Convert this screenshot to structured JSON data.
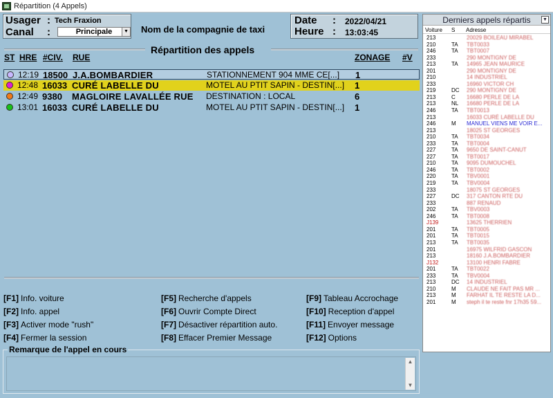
{
  "window": {
    "title": "Répartition (4 Appels)"
  },
  "header": {
    "usager_label": "Usager",
    "usager_sep": ":",
    "usager_value": "Tech Fraxion",
    "canal_label": "Canal",
    "canal_sep": ":",
    "canal_value": "Principale",
    "company": "Nom de la compagnie de taxi",
    "date_label": "Date",
    "date_sep": ":",
    "date_value": "2022/04/21",
    "heure_label": "Heure",
    "heure_sep": ":",
    "heure_value": "13:03:45"
  },
  "repartition": {
    "title": "Répartition des appels",
    "columns": {
      "st": "ST",
      "hre": "HRE",
      "civ": "#CIV.",
      "rue": "RUE",
      "zonage": "ZONAGE",
      "v": "#V"
    },
    "rows": [
      {
        "status_color": "#c8b8ff",
        "hre": "12:19",
        "civ": "18500",
        "rue": "J.A.BOMBARDIER",
        "dest": "STATIONNEMENT 904   MME CE[...]",
        "zone": "1"
      },
      {
        "status_color": "#e020d0",
        "hre": "12:48",
        "civ": "16033",
        "rue": "CURÉ LABELLE DU",
        "dest": "MOTEL AU PTIT SAPIN - DESTIN[...]",
        "zone": "1"
      },
      {
        "status_color": "#f07a18",
        "hre": "12:49",
        "civ": "9380",
        "rue": "MAGLOIRE LAVALLÉE RUE",
        "dest": "DESTINATION : LOCAL",
        "zone": "6"
      },
      {
        "status_color": "#18c018",
        "hre": "13:01",
        "civ": "16033",
        "rue": "CURÉ LABELLE DU",
        "dest": "MOTEL AU PTIT SAPIN - DESTIN[...]",
        "zone": "1"
      }
    ]
  },
  "fkeys": [
    {
      "key": "[F1]",
      "label": "Info. voiture"
    },
    {
      "key": "[F2]",
      "label": "Info. appel"
    },
    {
      "key": "[F3]",
      "label": "Activer mode \"rush\""
    },
    {
      "key": "[F4]",
      "label": "Fermer la session"
    },
    {
      "key": "[F5]",
      "label": "Recherche d'appels"
    },
    {
      "key": "[F6]",
      "label": "Ouvrir Compte Direct"
    },
    {
      "key": "[F7]",
      "label": "Désactiver répartition auto."
    },
    {
      "key": "[F8]",
      "label": "Effacer Premier Message"
    },
    {
      "key": "[F9]",
      "label": "Tableau Accrochage"
    },
    {
      "key": "[F10]",
      "label": "Reception d'appel"
    },
    {
      "key": "[F11]",
      "label": "Envoyer message"
    },
    {
      "key": "[F12]",
      "label": "Options"
    }
  ],
  "remarque": {
    "title": "Remarque de l'appel en cours"
  },
  "panel": {
    "title": "Derniers appels répartis",
    "col_voiture": "Voiture",
    "col_s": "S",
    "col_adresse": "Adresse",
    "rows": [
      {
        "v": "213",
        "s": "",
        "a": "20029 BOILEAU MIRABEL"
      },
      {
        "v": "210",
        "s": "TA",
        "a": "TBT0033"
      },
      {
        "v": "246",
        "s": "TA",
        "a": "TBT0007"
      },
      {
        "v": "233",
        "s": "",
        "a": "290 MONTIGNY DE"
      },
      {
        "v": "213",
        "s": "TA",
        "a": "14965 JEAN MAURICE"
      },
      {
        "v": "201",
        "s": "",
        "a": "290 MONTIGNY DE"
      },
      {
        "v": "210",
        "s": "",
        "a": "14 INDUSTRIEL"
      },
      {
        "v": "233",
        "s": "",
        "a": "16960 VICTOR CH"
      },
      {
        "v": "219",
        "s": "DC",
        "a": "290 MONTIGNY DE"
      },
      {
        "v": "213",
        "s": "C",
        "a": "16680 PERLE DE LA"
      },
      {
        "v": "213",
        "s": "NL",
        "a": "16680 PERLE DE LA"
      },
      {
        "v": "246",
        "s": "TA",
        "a": "TBT0013"
      },
      {
        "v": "213",
        "s": "",
        "a": "16033 CURÉ LABELLE DU"
      },
      {
        "v": "246",
        "s": "M",
        "a": "MANUEL VIENS ME VOIR E..."
      },
      {
        "v": "213",
        "s": "",
        "a": "18025 ST GEORGES"
      },
      {
        "v": "210",
        "s": "TA",
        "a": "TBT0034"
      },
      {
        "v": "233",
        "s": "TA",
        "a": "TBT0004"
      },
      {
        "v": "227",
        "s": "TA",
        "a": "9650 DE SAINT-CANUT"
      },
      {
        "v": "227",
        "s": "TA",
        "a": "TBT0017"
      },
      {
        "v": "210",
        "s": "TA",
        "a": "9095 DUMOUCHEL"
      },
      {
        "v": "246",
        "s": "TA",
        "a": "TBT0002"
      },
      {
        "v": "220",
        "s": "TA",
        "a": "TBV0001"
      },
      {
        "v": "219",
        "s": "TA",
        "a": "TBV0004"
      },
      {
        "v": "233",
        "s": "",
        "a": "18075 ST GEORGES"
      },
      {
        "v": "227",
        "s": "DC",
        "a": "317 CANTON RTE DU"
      },
      {
        "v": "233",
        "s": "",
        "a": "887 RENAUD"
      },
      {
        "v": "202",
        "s": "TA",
        "a": "TBV0003"
      },
      {
        "v": "246",
        "s": "TA",
        "a": "TBT0008"
      },
      {
        "v": "J139",
        "s": "",
        "a": "13625 THERRIEN"
      },
      {
        "v": "201",
        "s": "TA",
        "a": "TBT0005"
      },
      {
        "v": "201",
        "s": "TA",
        "a": "TBT0015"
      },
      {
        "v": "213",
        "s": "TA",
        "a": "TBT0035"
      },
      {
        "v": "201",
        "s": "",
        "a": "16975 WILFRID GASCON"
      },
      {
        "v": "213",
        "s": "",
        "a": "18160 J.A.BOMBARDIER"
      },
      {
        "v": "J132",
        "s": "",
        "a": "13100 HENRI FABRE"
      },
      {
        "v": "201",
        "s": "TA",
        "a": "TBT0022"
      },
      {
        "v": "233",
        "s": "TA",
        "a": "TBV0004"
      },
      {
        "v": "213",
        "s": "DC",
        "a": "14 INDUSTRIEL"
      },
      {
        "v": "210",
        "s": "M",
        "a": "CLAUDE NE FAIT PAS MR ..."
      },
      {
        "v": "213",
        "s": "M",
        "a": "FARHAT IL TE RESTE LA D..."
      },
      {
        "v": "201",
        "s": "M",
        "a": "steph il te reste fnr 17h35 59..."
      }
    ]
  }
}
